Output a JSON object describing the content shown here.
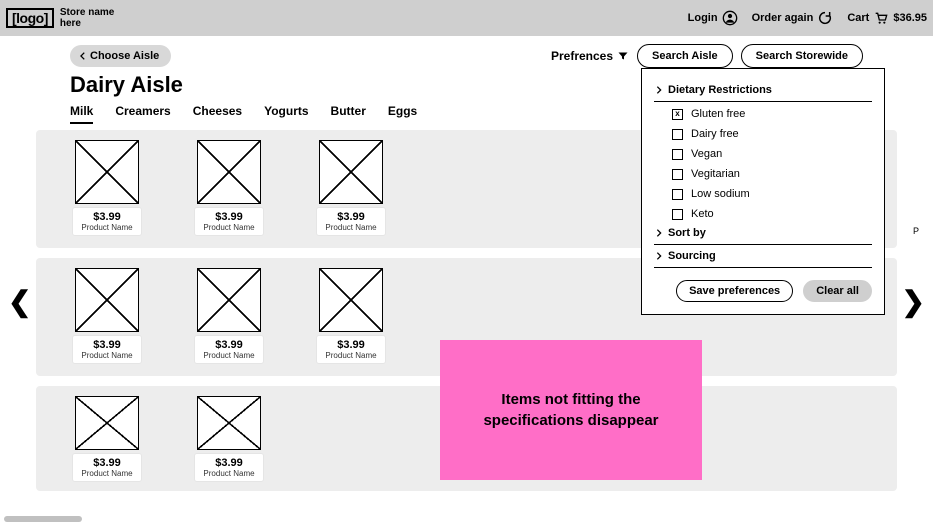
{
  "header": {
    "logo": "[logo]",
    "storeName": "Store name\nhere",
    "login": "Login",
    "orderAgain": "Order again",
    "cart": "Cart",
    "cartTotal": "$36.95"
  },
  "nav": {
    "chooseAisle": "Choose Aisle",
    "preferences": "Prefrences",
    "searchAisle": "Search Aisle",
    "searchStorewide": "Search Storewide"
  },
  "aisle": {
    "title": "Dairy Aisle",
    "tabs": [
      "Milk",
      "Creamers",
      "Cheeses",
      "Yogurts",
      "Butter",
      "Eggs"
    ],
    "activeTab": 0
  },
  "products": {
    "defaultPrice": "$3.99",
    "defaultName": "Product Name",
    "rowCounts": [
      3,
      3,
      2
    ],
    "peekLabel": "P"
  },
  "preferencesPanel": {
    "sections": {
      "dietary": "Dietary Restrictions",
      "sort": "Sort by",
      "sourcing": "Sourcing"
    },
    "options": [
      {
        "label": "Gluten free",
        "checked": true
      },
      {
        "label": "Dairy free",
        "checked": false
      },
      {
        "label": "Vegan",
        "checked": false
      },
      {
        "label": "Vegitarian",
        "checked": false
      },
      {
        "label": "Low sodium",
        "checked": false
      },
      {
        "label": "Keto",
        "checked": false
      }
    ],
    "save": "Save preferences",
    "clear": "Clear all"
  },
  "annotation": "Items not fitting the specifications disappear"
}
